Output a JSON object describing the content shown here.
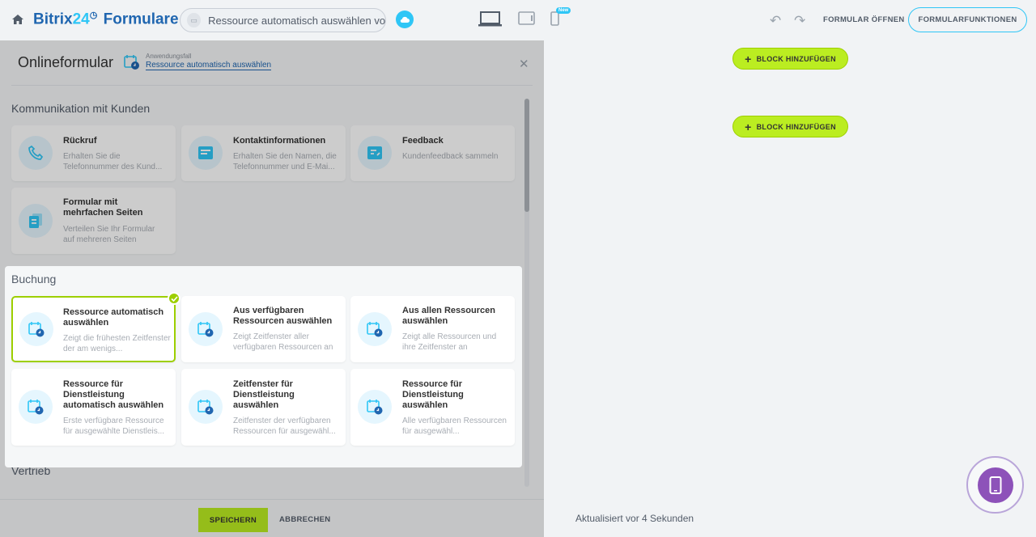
{
  "topbar": {
    "brand_bitrix": "Bitrix",
    "brand_24": "24",
    "brand_product": " Formulare",
    "form_title": "Ressource automatisch auswählen vo...",
    "new_badge": "New",
    "open_form": "FORMULAR ÖFFNEN",
    "form_functions": "FORMULARFUNKTIONEN"
  },
  "panel": {
    "title": "Onlineformular",
    "usecase_label": "Anwendungsfall",
    "usecase_value": "Ressource automatisch auswählen"
  },
  "sections": [
    {
      "heading": "Kommunikation mit Kunden",
      "cards": [
        {
          "title": "Rückruf",
          "desc": "Erhalten Sie die Telefonnummer des Kund..."
        },
        {
          "title": "Kontaktinformationen",
          "desc": "Erhalten Sie den Namen, die Telefonnummer und E-Mai..."
        },
        {
          "title": "Feedback",
          "desc": "Kundenfeedback sammeln"
        },
        {
          "title": "Formular mit mehrfachen Seiten",
          "desc": "Verteilen Sie Ihr Formular auf mehreren Seiten"
        }
      ]
    },
    {
      "heading": "Buchung",
      "cards": [
        {
          "title": "Ressource automatisch auswählen",
          "desc": "Zeigt die frühesten Zeitfenster der am wenigs..."
        },
        {
          "title": "Aus verfügbaren Ressourcen auswählen",
          "desc": "Zeigt Zeitfenster aller verfügbaren Ressourcen an"
        },
        {
          "title": "Aus allen Ressourcen auswählen",
          "desc": "Zeigt alle Ressourcen und ihre Zeitfenster an"
        },
        {
          "title": "Ressource für Dienstleistung automatisch auswählen",
          "desc": "Erste verfügbare Ressource für ausgewählte Dienstleis..."
        },
        {
          "title": "Zeitfenster für Dienstleistung auswählen",
          "desc": "Zeitfenster der verfügbaren Ressourcen für ausgewähl..."
        },
        {
          "title": "Ressource für Dienstleistung auswählen",
          "desc": "Alle verfügbaren Ressourcen für ausgewähl..."
        }
      ]
    },
    {
      "heading": "Vertrieb",
      "cards": []
    }
  ],
  "footer": {
    "save": "SPEICHERN",
    "cancel": "ABBRECHEN"
  },
  "canvas": {
    "add_block": "BLOCK HINZUFÜGEN",
    "updated": "Aktualisiert vor 4 Sekunden"
  },
  "colors": {
    "accent_green": "#bbed21",
    "accent_blue": "#2fc6f6",
    "brand_blue": "#2066b0"
  }
}
